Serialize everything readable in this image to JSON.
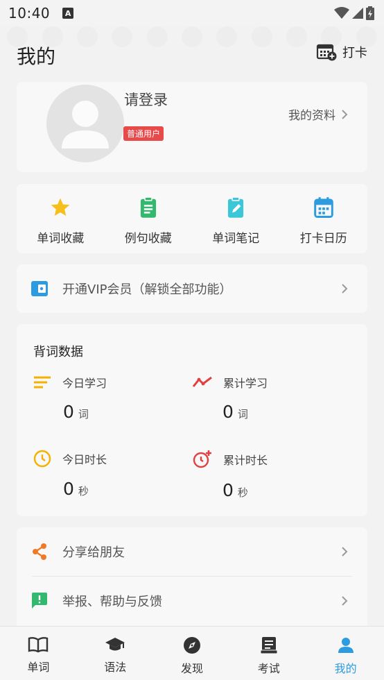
{
  "status_bar": {
    "time": "10:40",
    "notification_letter": "A"
  },
  "header": {
    "title": "我的",
    "checkin_label": "打卡"
  },
  "profile": {
    "login_text": "请登录",
    "user_badge": "普通用户",
    "profile_link": "我的资料"
  },
  "shortcuts": [
    {
      "label": "单词收藏",
      "icon": "star-icon",
      "color": "#f5c01b"
    },
    {
      "label": "例句收藏",
      "icon": "clipboard-icon",
      "color": "#34b76f"
    },
    {
      "label": "单词笔记",
      "icon": "note-edit-icon",
      "color": "#3cc7d8"
    },
    {
      "label": "打卡日历",
      "icon": "calendar-icon",
      "color": "#2d9be0"
    }
  ],
  "vip": {
    "label": "开通VIP会员（解锁全部功能）",
    "icon": "wallet-icon",
    "color": "#2d9be0"
  },
  "stats": {
    "title": "背词数据",
    "items": [
      {
        "label": "今日学习",
        "value": "0",
        "unit": "词",
        "icon": "list-icon",
        "color": "#f5b000"
      },
      {
        "label": "累计学习",
        "value": "0",
        "unit": "词",
        "icon": "trend-icon",
        "color": "#e04040"
      },
      {
        "label": "今日时长",
        "value": "0",
        "unit": "秒",
        "icon": "clock-icon",
        "color": "#f5b000"
      },
      {
        "label": "累计时长",
        "value": "0",
        "unit": "秒",
        "icon": "alarm-add-icon",
        "color": "#e04040"
      }
    ]
  },
  "menu": [
    {
      "label": "分享给朋友",
      "icon": "share-icon",
      "color": "#f07a24"
    },
    {
      "label": "举报、帮助与反馈",
      "icon": "feedback-icon",
      "color": "#34b76f"
    }
  ],
  "tabs": [
    {
      "label": "单词",
      "icon": "book-icon",
      "active": false
    },
    {
      "label": "语法",
      "icon": "graduation-cap-icon",
      "active": false
    },
    {
      "label": "发现",
      "icon": "compass-icon",
      "active": false
    },
    {
      "label": "考试",
      "icon": "exam-icon",
      "active": false
    },
    {
      "label": "我的",
      "icon": "person-icon",
      "active": true
    }
  ],
  "colors": {
    "accent": "#2d9be0",
    "badge": "#e84a4a",
    "background": "#f2f2f2",
    "card": "#f8f8f8"
  }
}
